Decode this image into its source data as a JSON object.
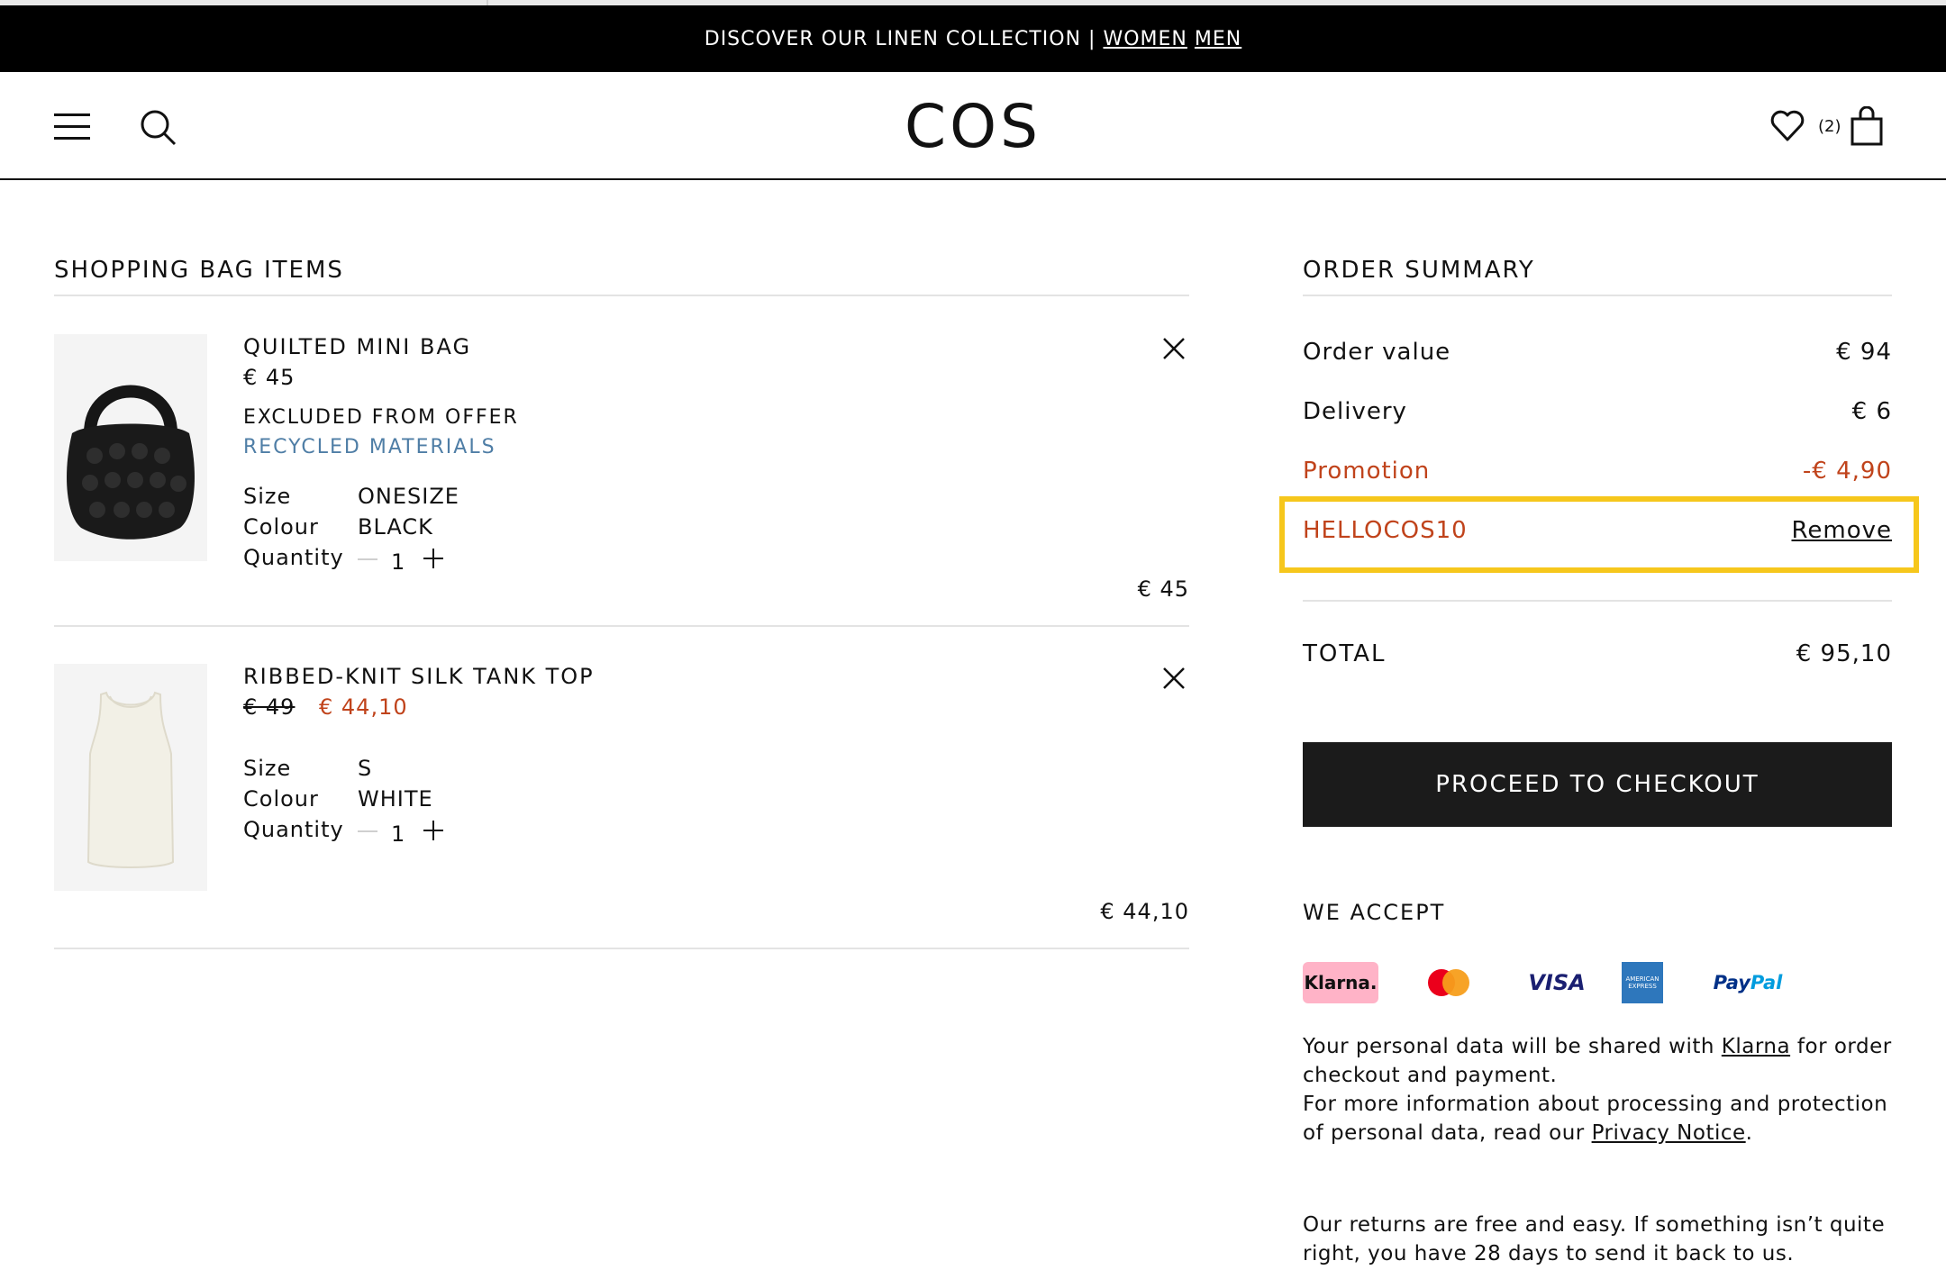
{
  "promo_bar": {
    "text": "DISCOVER OUR LINEN COLLECTION |",
    "women_link": "WOMEN",
    "men_link": "MEN"
  },
  "header": {
    "logo": "COS",
    "bag_count": "(2)",
    "icons": [
      "menu-icon",
      "search-icon",
      "heart-icon",
      "bag-icon"
    ]
  },
  "bag": {
    "title": "SHOPPING BAG ITEMS",
    "items": [
      {
        "name": "QUILTED MINI BAG",
        "price": "€ 45",
        "note": "EXCLUDED FROM OFFER",
        "tag": "RECYCLED MATERIALS",
        "size_label": "Size",
        "size": "ONESIZE",
        "colour_label": "Colour",
        "colour": "BLACK",
        "quantity_label": "Quantity",
        "quantity": "1",
        "line_total": "€ 45"
      },
      {
        "name": "RIBBED-KNIT SILK TANK TOP",
        "original_price": "€ 49",
        "sale_price": "€ 44,10",
        "size_label": "Size",
        "size": "S",
        "colour_label": "Colour",
        "colour": "WHITE",
        "quantity_label": "Quantity",
        "quantity": "1",
        "line_total": "€ 44,10"
      }
    ]
  },
  "summary": {
    "title": "ORDER SUMMARY",
    "order_value_label": "Order value",
    "order_value": "€ 94",
    "delivery_label": "Delivery",
    "delivery": "€ 6",
    "promotion_label": "Promotion",
    "promotion": "-€ 4,90",
    "code": "HELLOCOS10",
    "remove_label": "Remove",
    "total_label": "TOTAL",
    "total": "€ 95,10",
    "checkout_label": "PROCEED TO CHECKOUT"
  },
  "payment": {
    "title": "WE ACCEPT",
    "klarna": "Klarna.",
    "visa": "VISA",
    "amex": "AMERICAN EXPRESS",
    "paypal_a": "Pay",
    "paypal_b": "Pal",
    "colors": {
      "klarna": "#ffb3c7",
      "mc_red": "#eb001b",
      "mc_orange": "#f79e1b",
      "amex": "#2e77bc"
    }
  },
  "legal": {
    "p1_a": "Your personal data will be shared with",
    "p1_link": "Klarna",
    "p1_b": "for order checkout and payment.",
    "p2_a": "For more information about processing and protection of personal data, read our",
    "p2_link": "Privacy Notice",
    "p2_b": ".",
    "returns": "Our returns are free and easy. If something isn’t quite right, you have 28 days to send it back to us."
  },
  "colors": {
    "promo_red": "#c0431b",
    "highlight": "#f6c71c",
    "recycled_blue": "#4f7ea6"
  }
}
